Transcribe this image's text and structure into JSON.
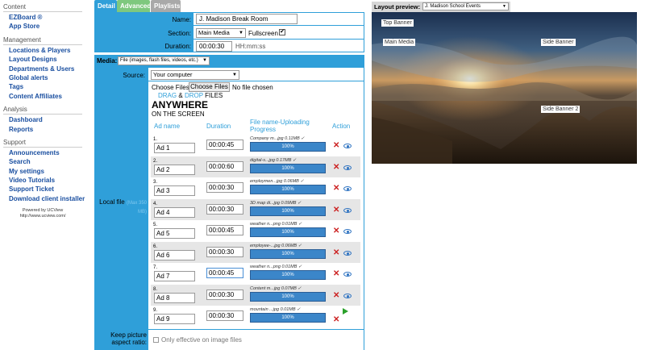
{
  "sidebar": {
    "sections": [
      {
        "title": "Content",
        "items": [
          "EZBoard ®",
          "App Store"
        ]
      },
      {
        "title": "Management",
        "items": [
          "Locations & Players",
          "Layout Designs",
          "Departments & Users",
          "Global alerts",
          "Tags",
          "Content Affiliates"
        ]
      },
      {
        "title": "Analysis",
        "items": [
          "Dashboard",
          "Reports"
        ]
      },
      {
        "title": "Support",
        "items": [
          "Announcements",
          "Search",
          "My settings",
          "Video Tutorials",
          "Support Ticket",
          "Download client installer"
        ]
      }
    ],
    "powered_line1": "Powered by UCView",
    "powered_line2": "http://www.ucview.com/"
  },
  "tabs": {
    "detail": "Detail",
    "advanced": "Advanced",
    "playlists": "Playlists"
  },
  "form": {
    "name_label": "Name:",
    "name_value": "J. Madison Break Room",
    "section_label": "Section:",
    "section_value": "Main Media",
    "fullscreen_label": "Fullscreen",
    "fullscreen_checked": true,
    "duration_label": "Duration:",
    "duration_value": "00:00:30",
    "duration_hint": "HH:mm:ss"
  },
  "media": {
    "label": "Media:",
    "type_value": "File (images, flash files, videos, etc.)",
    "source_label": "Source:",
    "source_value": "Your computer",
    "choose_files_text": "Choose Files",
    "choose_files_button": "Choose Files",
    "no_file_text": "No file chosen",
    "drag_word": "DRAG",
    "amp": "&",
    "drop_word": "DROP",
    "files_word": "FILES",
    "anywhere": "ANYWHERE",
    "on_screen": "ON THE SCREEN",
    "local_file_label": "Local file",
    "local_file_hint": "(Max 350 MB)",
    "keep_aspect_label_1": "Keep picture",
    "keep_aspect_label_2": "aspect ratio:",
    "keep_aspect_option": "Only effective on image files"
  },
  "table": {
    "col_ad_name": "Ad name",
    "col_duration": "Duration",
    "col_file_1": "File name-Uploading",
    "col_file_2": "Progress",
    "col_action": "Action",
    "rows": [
      {
        "num": "1.",
        "name": "Ad 1",
        "duration": "00:00:45",
        "file": "Company m...jpg 0.11MB ✓",
        "progress": "100%"
      },
      {
        "num": "2.",
        "name": "Ad 2",
        "duration": "00:00:60",
        "file": "digital-s...jpg 0.17MB ✓",
        "progress": "100%"
      },
      {
        "num": "3.",
        "name": "Ad 3",
        "duration": "00:00:30",
        "file": "employmen...jpg 0.06MB ✓",
        "progress": "100%"
      },
      {
        "num": "4.",
        "name": "Ad 4",
        "duration": "00:00:30",
        "file": "3D map di...jpg 0.09MB ✓",
        "progress": "100%"
      },
      {
        "num": "5.",
        "name": "Ad 5",
        "duration": "00:00:45",
        "file": "weather n...png 0.01MB ✓",
        "progress": "100%"
      },
      {
        "num": "6.",
        "name": "Ad 6",
        "duration": "00:00:30",
        "file": "employee-...jpg 0.06MB ✓",
        "progress": "100%"
      },
      {
        "num": "7.",
        "name": "Ad 7",
        "duration": "00:00:45",
        "file": "weather n...png 0.01MB ✓",
        "progress": "100%"
      },
      {
        "num": "8.",
        "name": "Ad 8",
        "duration": "00:00:30",
        "file": "Content m...jpg 0.07MB ✓",
        "progress": "100%"
      },
      {
        "num": "9.",
        "name": "Ad 9",
        "duration": "00:00:30",
        "file": "mountain ...jpg 0.01MB ✓",
        "progress": "100%"
      }
    ]
  },
  "preview": {
    "label": "Layout preview:",
    "select_value": "J. Madison School Events",
    "zones": {
      "top_banner": "Top Banner",
      "main_media": "Main Media",
      "side_banner": "Side Banner",
      "side_banner_2": "Side Banner 2"
    }
  },
  "colors": {
    "panel_blue": "#2f9fd9",
    "link_blue": "#1a4fa0",
    "progress_blue": "#3b86c9",
    "tab_green": "#7ec87e"
  }
}
